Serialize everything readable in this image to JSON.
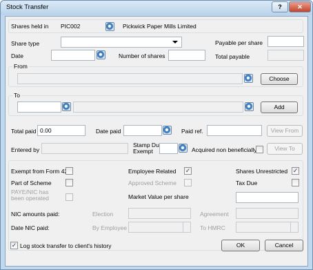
{
  "window": {
    "title": "Stock Transfer",
    "help": "?",
    "close": "✕"
  },
  "shares_held": {
    "label": "Shares held in",
    "code": "PIC002",
    "name": "Pickwick Paper Mills Limited"
  },
  "share_type": {
    "label": "Share type",
    "value": ""
  },
  "payable_per_share": {
    "label": "Payable per share",
    "value": ""
  },
  "date": {
    "label": "Date",
    "value": ""
  },
  "number_of_shares": {
    "label": "Number of shares",
    "value": ""
  },
  "total_payable": {
    "label": "Total payable",
    "value": ""
  },
  "from": {
    "label": "From",
    "value": "",
    "choose_label": "Choose"
  },
  "to": {
    "label": "To",
    "code": "",
    "name": "",
    "add_label": "Add"
  },
  "total_paid": {
    "label": "Total paid",
    "value": "0.00"
  },
  "date_paid": {
    "label": "Date paid",
    "value": ""
  },
  "paid_ref": {
    "label": "Paid ref.",
    "value": ""
  },
  "view_from_label": "View From",
  "entered_by": {
    "label": "Entered by",
    "value": ""
  },
  "stamp_duty_exempt": {
    "label": "Stamp Duty Exempt",
    "value": ""
  },
  "acquired_non_beneficially": {
    "label": "Acquired non beneficially",
    "checked": false
  },
  "view_to_label": "View To",
  "options": {
    "exempt_form42": {
      "label": "Exempt from Form 42",
      "checked": false
    },
    "employee_related": {
      "label": "Employee Related",
      "checked": true
    },
    "shares_unrestricted": {
      "label": "Shares Unrestricted",
      "checked": true
    },
    "part_of_scheme": {
      "label": "Part of Scheme",
      "checked": false
    },
    "approved_scheme": {
      "label": "Approved Scheme",
      "checked": false
    },
    "tax_due": {
      "label": "Tax Due",
      "checked": false
    },
    "paye_nic": {
      "label": "PAYE/NIC has been operated",
      "checked": false
    }
  },
  "market_value": {
    "label": "Market Value per share",
    "value": ""
  },
  "nic": {
    "amounts_label": "NIC amounts paid:",
    "election_label": "Election",
    "agreement_label": "Agreement",
    "date_label": "Date NIC paid:",
    "by_employee_label": "By Employee",
    "to_hmrc_label": "To HMRC"
  },
  "log": {
    "label": "Log stock transfer to client's history",
    "checked": true
  },
  "ok_label": "OK",
  "cancel_label": "Cancel"
}
